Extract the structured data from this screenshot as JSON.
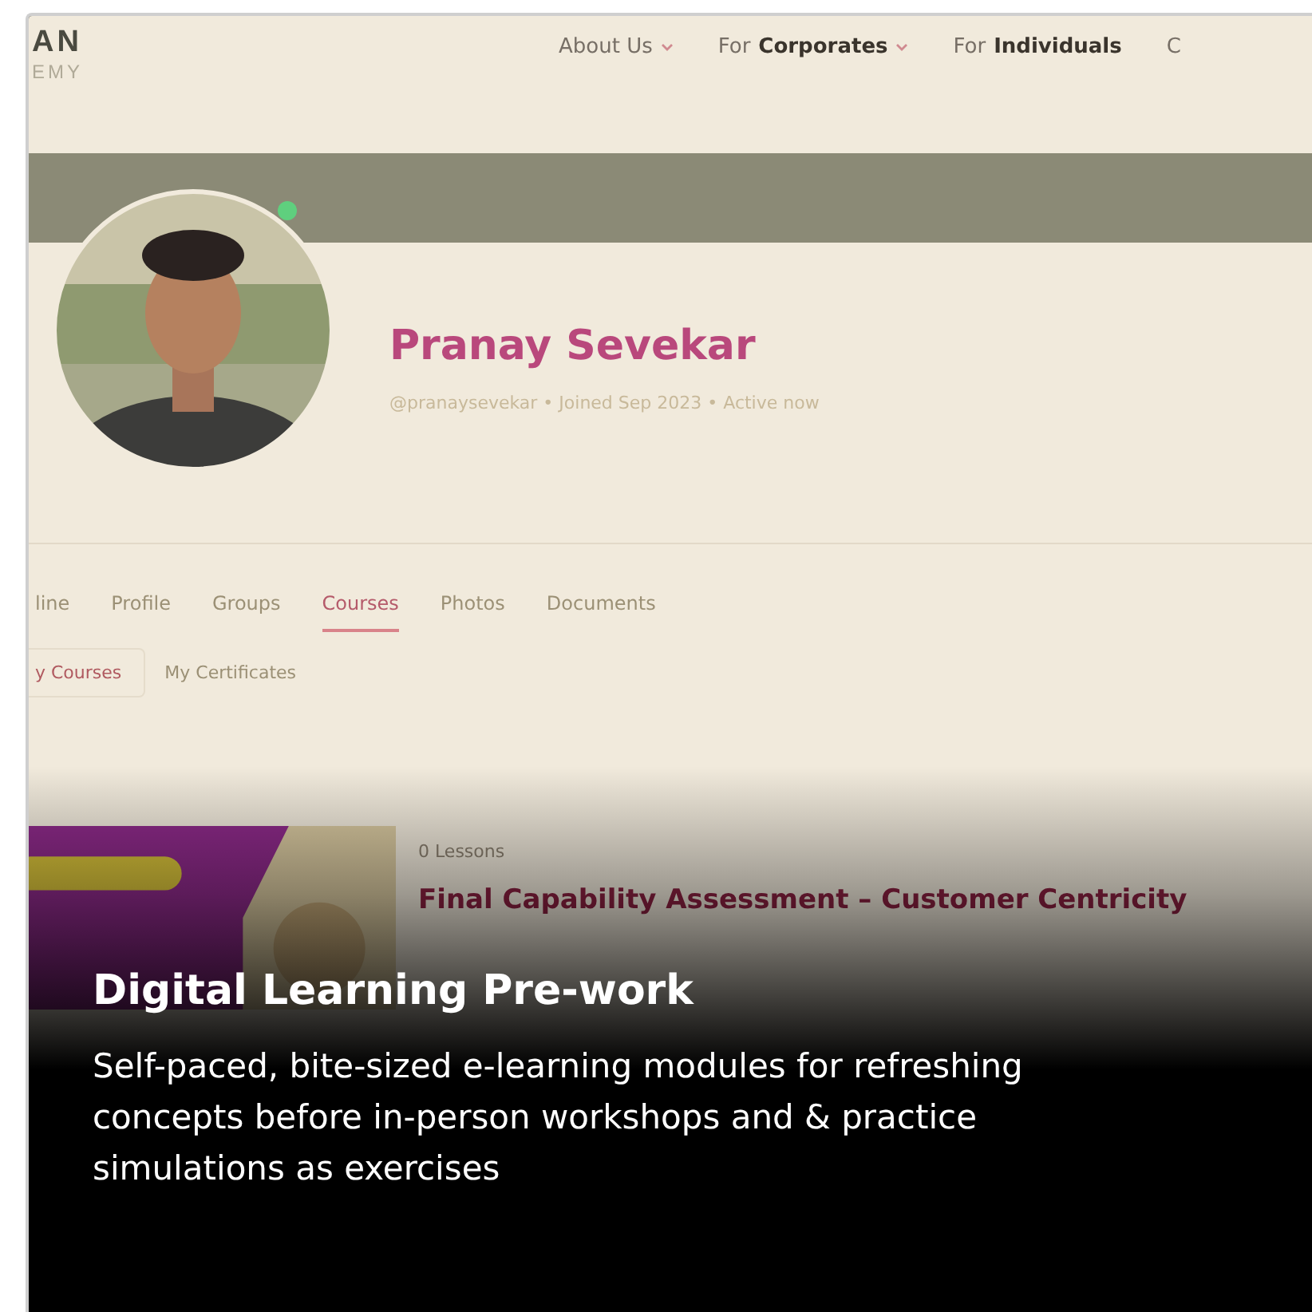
{
  "shot": {
    "logo": {
      "line_1": "AN",
      "line_2": "EMY"
    },
    "nav": [
      {
        "label": "About Us",
        "dropdown": true
      },
      {
        "prefix": "For",
        "label": "Corporates",
        "dropdown": true
      },
      {
        "prefix": "For",
        "label": "Individuals",
        "dropdown": false
      },
      {
        "label": "C",
        "dropdown": false
      }
    ],
    "profile": {
      "name": "Pranay Sevekar",
      "meta": "@pranaysevekar • Joined Sep 2023 • Active now",
      "online": true
    },
    "tabs": [
      {
        "label": "line",
        "selected": false
      },
      {
        "label": "Profile",
        "selected": false
      },
      {
        "label": "Groups",
        "selected": false
      },
      {
        "label": "Courses",
        "selected": true
      },
      {
        "label": "Photos",
        "selected": false
      },
      {
        "label": "Documents",
        "selected": false
      }
    ],
    "subtabs": [
      {
        "label": "y Courses",
        "selected": true
      },
      {
        "label": "My Certificates",
        "selected": false
      }
    ],
    "course": {
      "lessons": "0 Lessons",
      "title": "Final Capability Assessment – Customer Centricity"
    }
  },
  "caption": {
    "title": "Digital Learning Pre-work",
    "text": "Self-paced, bite-sized e-learning modules for refreshing concepts before in-person workshops and & practice simulations as exercises"
  }
}
